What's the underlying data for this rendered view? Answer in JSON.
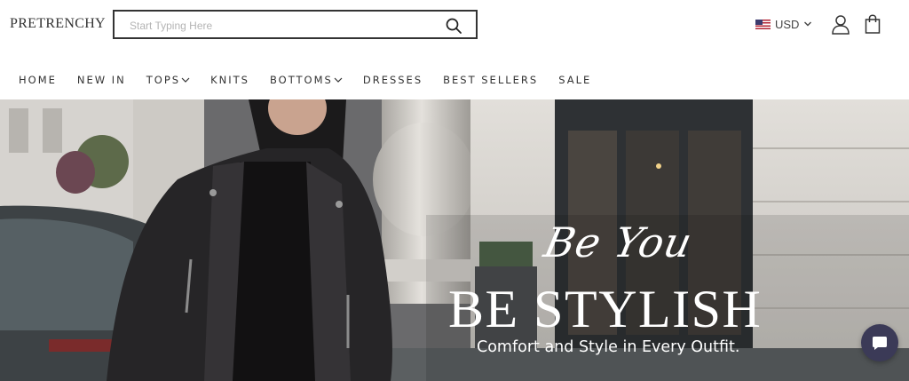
{
  "header": {
    "logo": "PRETRENCHY",
    "search": {
      "placeholder": "Start Typing Here",
      "value": ""
    },
    "currency": {
      "code": "USD",
      "flag_icon": "us-flag-icon"
    }
  },
  "nav": {
    "items": [
      {
        "label": "HOME",
        "has_dropdown": false
      },
      {
        "label": "NEW IN",
        "has_dropdown": false
      },
      {
        "label": "TOPS",
        "has_dropdown": true
      },
      {
        "label": "KNITS",
        "has_dropdown": false
      },
      {
        "label": "BOTTOMS",
        "has_dropdown": true
      },
      {
        "label": "DRESSES",
        "has_dropdown": false
      },
      {
        "label": "BEST SELLERS",
        "has_dropdown": false
      },
      {
        "label": "SALE",
        "has_dropdown": false
      }
    ]
  },
  "hero": {
    "script_text": "Be You",
    "title": "BE STYLISH",
    "tagline": "Comfort and Style in Every Outfit."
  },
  "colors": {
    "text": "#333333",
    "chat_bubble": "#3b3a57",
    "hero_text": "#ffffff"
  },
  "icons": [
    "search-icon",
    "chevron-down-icon",
    "account-icon",
    "cart-icon",
    "chat-icon"
  ]
}
